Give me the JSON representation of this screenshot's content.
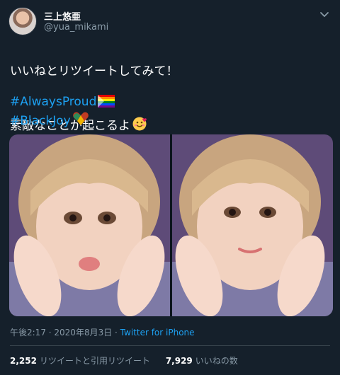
{
  "user": {
    "display_name": "三上悠亜",
    "handle": "@yua_mikami"
  },
  "tweet": {
    "line1": "いいねとリツイートしてみて！",
    "line2": "素敵なことが起こるよ",
    "hashtags": [
      "#AlwaysProud",
      "#BlackJoy"
    ]
  },
  "meta": {
    "time": "午後2:17",
    "sep1": " · ",
    "date": "2020年8月3日",
    "sep2": " · ",
    "source": "Twitter for iPhone"
  },
  "stats": {
    "retweets": "2,252",
    "retweets_label": "リツイートと引用リツイート",
    "likes": "7,929",
    "likes_label": "いいねの数"
  },
  "icons": {
    "menu": "chevron-down-icon",
    "emoji1": "smiling-face-with-hearts-emoji",
    "emoji2": "rainbow-flag-emoji",
    "emoji3": "heart-emoji"
  },
  "colors": {
    "background": "#15202b",
    "link": "#1da1f2",
    "secondary": "#8899a6"
  }
}
